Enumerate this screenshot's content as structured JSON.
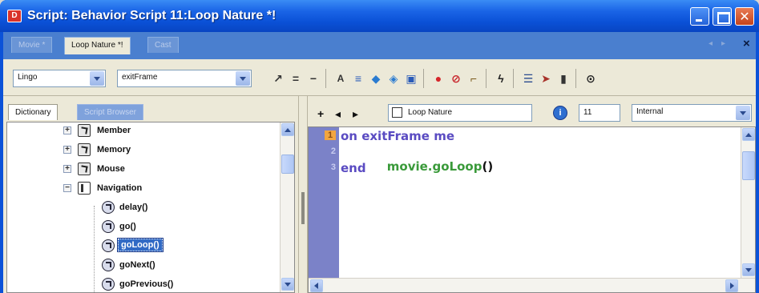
{
  "window": {
    "title": "Script: Behavior Script 11:Loop Nature *!",
    "app_icon": "D",
    "close_glyph": "✕"
  },
  "tabs": [
    {
      "label": "Movie *",
      "active": false
    },
    {
      "label": "Loop Nature *!",
      "active": true
    },
    {
      "label": "Cast",
      "active": false
    }
  ],
  "tab_close_glyph": "×",
  "toolbar": {
    "language_select": "Lingo",
    "handler_select": "exitFrame",
    "icons": [
      "go-to-handler-icon",
      "comment-icon",
      "uncomment-icon",
      "alphabetical-lingo-icon",
      "categorized-lingo-icon",
      "scripting-objects-icon",
      "3d-lingo-icon",
      "scripting-xtras-icon",
      "toggle-breakpoint-icon",
      "ignore-breakpoints-icon",
      "watch-expression-icon",
      "recompile-icon",
      "reference-icon",
      "debugger-icon",
      "message-window-icon",
      "help-icon"
    ]
  },
  "left_pane": {
    "tabs": {
      "dictionary": "Dictionary",
      "script_browser": "Script Browser"
    },
    "tree": [
      {
        "label": "Member",
        "type": "object",
        "expander": "+"
      },
      {
        "label": "Memory",
        "type": "object",
        "expander": "+"
      },
      {
        "label": "Mouse",
        "type": "object",
        "expander": "+"
      },
      {
        "label": "Navigation",
        "type": "book",
        "expander": "−"
      },
      {
        "label": "delay()",
        "type": "method"
      },
      {
        "label": "go()",
        "type": "method"
      },
      {
        "label": "goLoop()",
        "type": "method",
        "selected": true
      },
      {
        "label": "goNext()",
        "type": "method"
      },
      {
        "label": "goPrevious()",
        "type": "method"
      }
    ]
  },
  "right_pane": {
    "cast_member_name": "Loop Nature",
    "cast_member_number": "11",
    "cast_library": "Internal",
    "nav": {
      "new": "+",
      "prev": "◂",
      "next": "▸"
    },
    "code": {
      "line_numbers": [
        "1",
        "2",
        "3"
      ],
      "line1_keyword": "on exitFrame me",
      "line2_call": "movie.goLoop",
      "line2_parens": "()",
      "line3_keyword": "end"
    }
  },
  "colors": {
    "title_bar": "#0a50d6",
    "chrome": "#ece9d8",
    "gutter": "#7b82c8",
    "keyword": "#5a4bc2",
    "call": "#3a9a3a",
    "selection": "#316ac5"
  }
}
